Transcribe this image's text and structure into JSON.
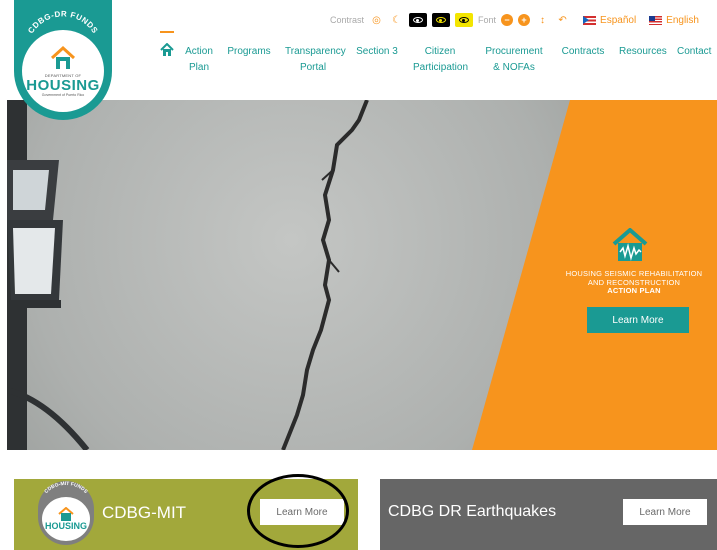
{
  "header": {
    "logo": {
      "arc_text": "CDBG-DR FUNDS",
      "dept_text": "DEPARTMENT OF",
      "word": "HOUSING",
      "sub_text": "Government of Puerto Rico"
    },
    "toolbar": {
      "contrast_label": "Contrast",
      "font_label": "Font",
      "font_decrease": "−",
      "font_increase": "+",
      "languages": [
        {
          "label": "Español"
        },
        {
          "label": "English"
        }
      ]
    },
    "nav": [
      {
        "label": "Action Plan"
      },
      {
        "label": "Programs"
      },
      {
        "label": "Transparency Portal"
      },
      {
        "label": "Section 3"
      },
      {
        "label": "Citizen Participation"
      },
      {
        "label": "Procurement & NOFAs"
      },
      {
        "label": "Contracts"
      },
      {
        "label": "Resources"
      },
      {
        "label": "Contact"
      }
    ]
  },
  "hero": {
    "title_line1": "HOUSING SEISMIC REHABILITATION",
    "title_line2": "AND RECONSTRUCTION",
    "title_line3": "ACTION PLAN",
    "button_label": "Learn More"
  },
  "cards": [
    {
      "logo_arc_text": "CDBG-MIT FUNDS",
      "logo_word": "HOUSING",
      "title": "CDBG-MIT",
      "button_label": "Learn More",
      "color": "#a2a83b"
    },
    {
      "title": "CDBG DR Earthquakes",
      "button_label": "Learn More",
      "color": "#666666"
    }
  ],
  "colors": {
    "teal": "#1a9a93",
    "orange": "#f7941d",
    "olive": "#a2a83b",
    "gray": "#666666"
  }
}
